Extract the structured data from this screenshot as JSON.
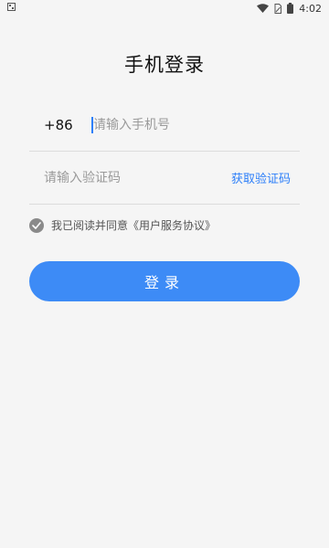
{
  "status_bar": {
    "time": "4:02",
    "icons": [
      "notification-icon",
      "wifi-icon",
      "sim-icon",
      "battery-icon"
    ]
  },
  "page": {
    "title": "手机登录"
  },
  "phone": {
    "country_code": "+86",
    "placeholder": "请输入手机号",
    "value": ""
  },
  "code": {
    "placeholder": "请输入验证码",
    "value": "",
    "get_code_label": "获取验证码"
  },
  "agreement": {
    "text": "我已阅读并同意《用户服务协议》",
    "checked": true
  },
  "login": {
    "label": "登录"
  },
  "colors": {
    "accent": "#3d8bf6",
    "link": "#2d7ff9",
    "background": "#f5f5f5",
    "divider": "#dcdcdc"
  }
}
